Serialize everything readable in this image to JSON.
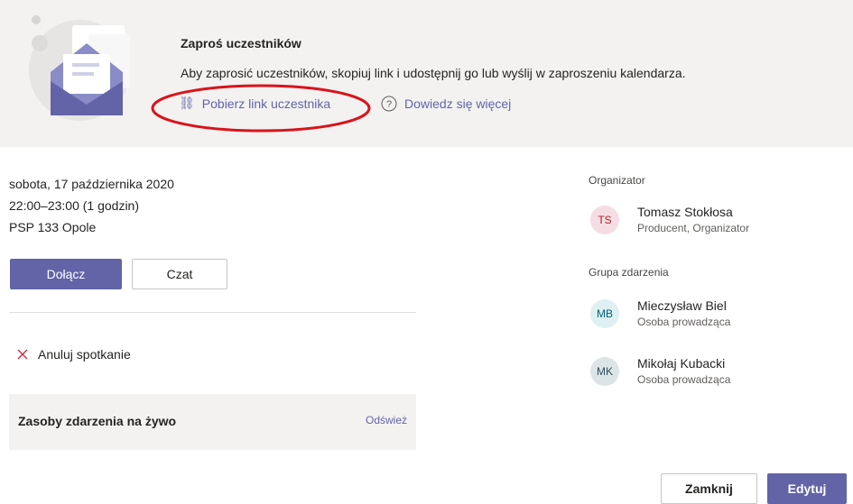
{
  "banner": {
    "title": "Zaproś uczestników",
    "description": "Aby zaprosić uczestników, skopiuj link i udostępnij go lub wyślij w zaproszeniu kalendarza.",
    "get_link_label": "Pobierz link uczestnika",
    "learn_more_label": "Dowiedz się więcej"
  },
  "event": {
    "date": "sobota, 17 października 2020",
    "time": "22:00–23:00 (1 godzin)",
    "location": "PSP 133 Opole"
  },
  "actions": {
    "join_label": "Dołącz",
    "chat_label": "Czat",
    "cancel_label": "Anuluj spotkanie"
  },
  "resources": {
    "title": "Zasoby zdarzenia na żywo",
    "refresh_label": "Odśwież"
  },
  "organizer": {
    "section_label": "Organizator",
    "initials": "TS",
    "name": "Tomasz Stokłosa",
    "role": "Producent, Organizator",
    "color": "#f6dde3"
  },
  "group": {
    "section_label": "Grupa zdarzenia",
    "members": [
      {
        "initials": "MB",
        "name": "Mieczysław Biel",
        "role": "Osoba prowadząca",
        "color": "#dff0f3"
      },
      {
        "initials": "MK",
        "name": "Mikołaj Kubacki",
        "role": "Osoba prowadząca",
        "color": "#dce4e6"
      }
    ]
  },
  "footer": {
    "close_label": "Zamknij",
    "edit_label": "Edytuj"
  },
  "colors": {
    "accent": "#6264a7",
    "annotation": "#d9141b"
  }
}
